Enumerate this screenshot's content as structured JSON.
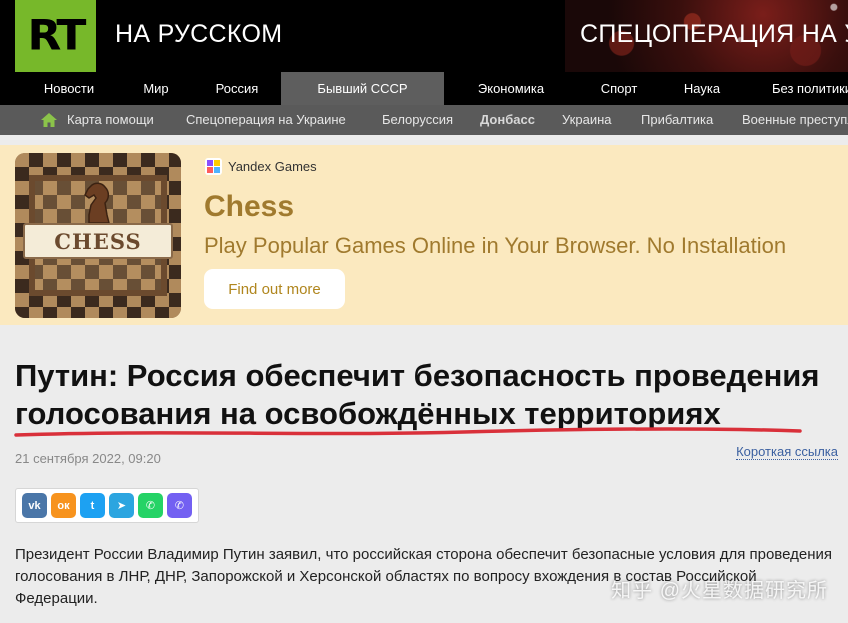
{
  "header": {
    "logo": "RT",
    "site_name": "НА РУССКОМ",
    "promo": "СПЕЦОПЕРАЦИЯ НА УКРАИНЕ"
  },
  "main_nav": [
    "Новости",
    "Мир",
    "Россия",
    "Бывший СССР",
    "Экономика",
    "Спорт",
    "Наука",
    "Без политики"
  ],
  "main_nav_active": "Бывший СССР",
  "sub_nav": [
    "Карта помощи",
    "Спецоперация на Украине",
    "Белоруссия",
    "Донбасс",
    "Украина",
    "Прибалтика",
    "Военные преступления"
  ],
  "sub_nav_active": "Донбасс",
  "ad": {
    "brand": "Yandex Games",
    "thumb_label": "CHESS",
    "title": "Chess",
    "subtitle": "Play Popular Games Online in Your Browser. No Installation",
    "button": "Find out more"
  },
  "article": {
    "headline": "Путин: Россия обеспечит безопасность проведения голосования на освобождённых территориях",
    "date": "21 сентября 2022, 09:20",
    "short_link": "Короткая ссылка",
    "body": "Президент России Владимир Путин заявил, что российская сторона обеспечит безопасные условия для проведения голосования в ЛНР, ДНР, Запорожской и Херсонской областях по вопросу вхождения в состав Российской Федерации."
  },
  "share_buttons": [
    {
      "name": "vk",
      "label": "vk",
      "color": "#4a76a8"
    },
    {
      "name": "ok",
      "label": "ок",
      "color": "#f7931e"
    },
    {
      "name": "twitter",
      "label": "t",
      "color": "#1da1f2"
    },
    {
      "name": "telegram",
      "label": "➤",
      "color": "#2ca5e0"
    },
    {
      "name": "whatsapp",
      "label": "✆",
      "color": "#25d366"
    },
    {
      "name": "viber",
      "label": "✆",
      "color": "#7360f2"
    }
  ],
  "watermark": "知乎 @火星数据研究所",
  "colors": {
    "rt_green": "#77b82a",
    "accent_underline": "#d9303a",
    "ad_bg": "#fbe9bf",
    "ad_text": "#a07a2e"
  }
}
